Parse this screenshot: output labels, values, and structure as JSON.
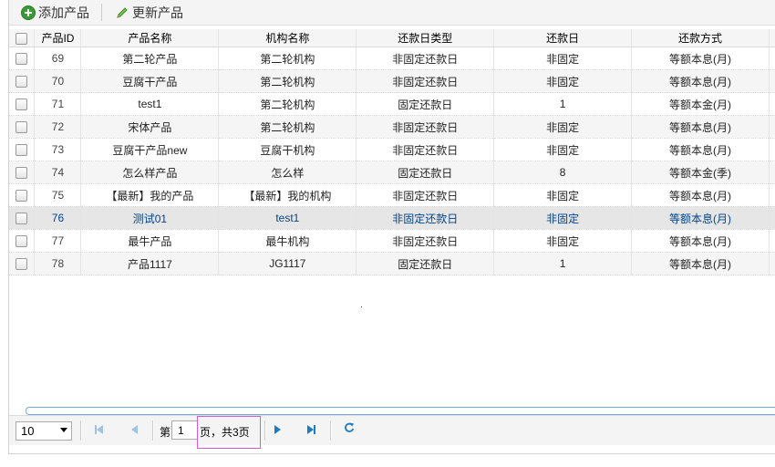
{
  "toolbar": {
    "add_label": "添加产品",
    "update_label": "更新产品"
  },
  "grid": {
    "columns": [
      "产品ID",
      "产品名称",
      "机构名称",
      "还款日类型",
      "还款日",
      "还款方式"
    ],
    "rows": [
      {
        "id": "69",
        "name": "第二轮产品",
        "org": "第二轮机构",
        "day_type": "非固定还款日",
        "day": "非固定",
        "method": "等额本息(月)"
      },
      {
        "id": "70",
        "name": "豆腐干产品",
        "org": "第二轮机构",
        "day_type": "非固定还款日",
        "day": "非固定",
        "method": "等额本息(月)"
      },
      {
        "id": "71",
        "name": "test1",
        "org": "第二轮机构",
        "day_type": "固定还款日",
        "day": "1",
        "method": "等额本金(月)"
      },
      {
        "id": "72",
        "name": "宋体产品",
        "org": "第二轮机构",
        "day_type": "非固定还款日",
        "day": "非固定",
        "method": "等额本息(月)"
      },
      {
        "id": "73",
        "name": "豆腐干产品new",
        "org": "豆腐干机构",
        "day_type": "非固定还款日",
        "day": "非固定",
        "method": "等额本息(月)"
      },
      {
        "id": "74",
        "name": "怎么样产品",
        "org": "怎么样",
        "day_type": "固定还款日",
        "day": "8",
        "method": "等额本金(季)"
      },
      {
        "id": "75",
        "name": "【最新】我的产品",
        "org": "【最新】我的机构",
        "day_type": "非固定还款日",
        "day": "非固定",
        "method": "等额本息(月)"
      },
      {
        "id": "76",
        "name": "测试01",
        "org": "test1",
        "day_type": "非固定还款日",
        "day": "非固定",
        "method": "等额本息(月)"
      },
      {
        "id": "77",
        "name": "最牛产品",
        "org": "最牛机构",
        "day_type": "非固定还款日",
        "day": "非固定",
        "method": "等额本息(月)"
      },
      {
        "id": "78",
        "name": "产品1117",
        "org": "JG1117",
        "day_type": "固定还款日",
        "day": "1",
        "method": "等额本息(月)"
      }
    ],
    "selected_row": "76"
  },
  "pager": {
    "page_size": "10",
    "page_prefix": "第",
    "page_value": "1",
    "page_suffix": "页，共3页"
  },
  "colors": {
    "selected_text": "#00438a",
    "nav_active": "#1b7ac4",
    "nav_disabled": "#9fc3e3",
    "highlight_box": "#d25dd2",
    "add_icon": "#3a9a35"
  },
  "icons": [
    "add-icon",
    "pencil-icon",
    "first-page-icon",
    "prev-page-icon",
    "next-page-icon",
    "last-page-icon",
    "refresh-icon",
    "chevron-down-icon"
  ]
}
